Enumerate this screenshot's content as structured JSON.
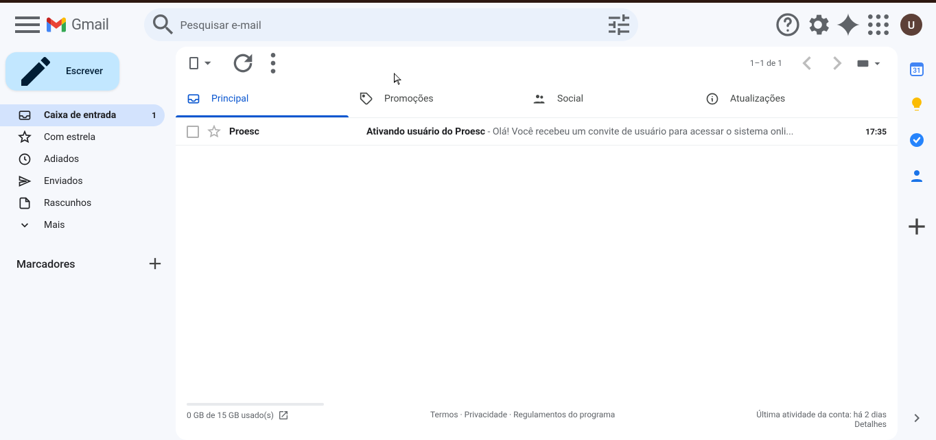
{
  "header": {
    "brand": "Gmail",
    "search_placeholder": "Pesquisar e-mail",
    "avatar_letter": "U"
  },
  "compose_label": "Escrever",
  "nav": [
    {
      "label": "Caixa de entrada",
      "count": "1",
      "icon": "inbox",
      "active": true
    },
    {
      "label": "Com estrela",
      "icon": "star"
    },
    {
      "label": "Adiados",
      "icon": "clock"
    },
    {
      "label": "Enviados",
      "icon": "send"
    },
    {
      "label": "Rascunhos",
      "icon": "draft"
    },
    {
      "label": "Mais",
      "icon": "expand"
    }
  ],
  "labels_header": "Marcadores",
  "toolbar": {
    "pager": "1–1 de 1"
  },
  "tabs": [
    {
      "label": "Principal",
      "icon": "inbox-tab",
      "active": true
    },
    {
      "label": "Promoções",
      "icon": "tag"
    },
    {
      "label": "Social",
      "icon": "people"
    },
    {
      "label": "Atualizações",
      "icon": "info"
    }
  ],
  "mails": [
    {
      "sender": "Proesc",
      "subject": "Ativando usuário do Proesc",
      "snippet": " - Olá! Você recebeu um convite de usuário para acessar o sistema onli...",
      "time": "17:35"
    }
  ],
  "footer": {
    "storage": "0 GB de 15 GB usado(s)",
    "terms": "Termos",
    "privacy": "Privacidade",
    "program": "Regulamentos do programa",
    "activity": "Última atividade da conta: há 2 dias",
    "details": "Detalhes",
    "sep": " · "
  }
}
